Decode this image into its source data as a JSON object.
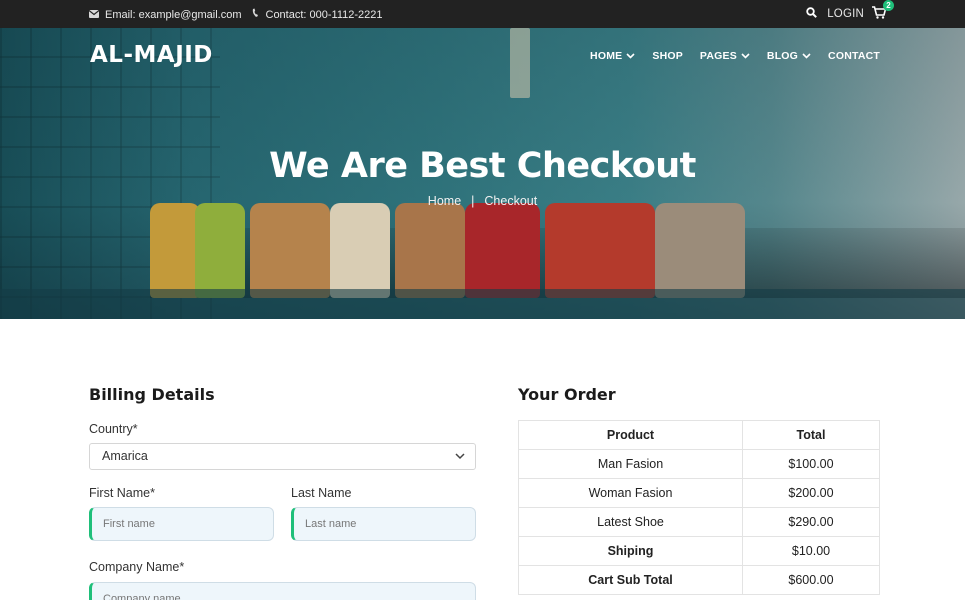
{
  "topbar": {
    "email": "Email: example@gmail.com",
    "contact": "Contact: 000-1112-2221",
    "login": "LOGIN",
    "cart_count": "2"
  },
  "header": {
    "logo": "AL-MAJID",
    "nav": [
      {
        "label": "HOME",
        "dropdown": true
      },
      {
        "label": "SHOP",
        "dropdown": false
      },
      {
        "label": "PAGES",
        "dropdown": true
      },
      {
        "label": "BLOG",
        "dropdown": true
      },
      {
        "label": "CONTACT",
        "dropdown": false
      }
    ]
  },
  "hero": {
    "title": "We Are Best Checkout",
    "breadcrumb": {
      "home": "Home",
      "separator": "|",
      "current": "Checkout"
    }
  },
  "billing": {
    "title": "Billing Details",
    "country_label": "Country*",
    "country_value": "Amarica",
    "first_name_label": "First Name*",
    "first_name_placeholder": "First name",
    "last_name_label": "Last Name",
    "last_name_placeholder": "Last name",
    "company_label": "Company Name*",
    "company_placeholder": "Company name"
  },
  "order": {
    "title": "Your Order",
    "headers": [
      "Product",
      "Total"
    ],
    "rows": [
      {
        "product": "Man Fasion",
        "total": "$100.00"
      },
      {
        "product": "Woman Fasion",
        "total": "$200.00"
      },
      {
        "product": "Latest Shoe",
        "total": "$290.00"
      },
      {
        "product": "Shiping",
        "total": "$10.00"
      },
      {
        "product": "Cart Sub Total",
        "total": "$600.00"
      }
    ]
  },
  "colors": {
    "topbar_bg": "#222222",
    "accent": "#1fbf7a",
    "hero_teal": "#2f7a84",
    "input_bg": "#eef6fb"
  }
}
